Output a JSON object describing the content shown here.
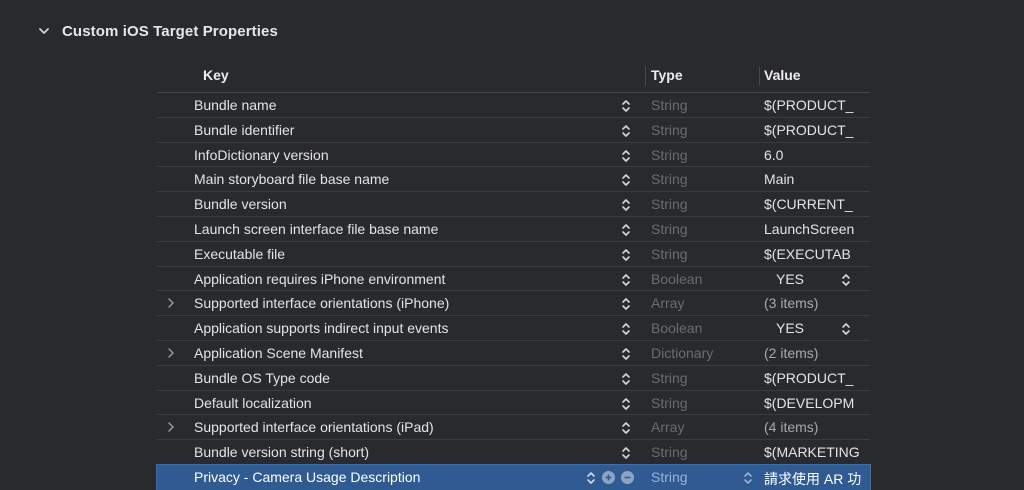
{
  "section": {
    "title": "Custom iOS Target Properties"
  },
  "columns": {
    "key": "Key",
    "type": "Type",
    "value": "Value"
  },
  "rows": [
    {
      "key": "Bundle name",
      "type": "String",
      "value": "$(PRODUCT_",
      "expandable": false
    },
    {
      "key": "Bundle identifier",
      "type": "String",
      "value": "$(PRODUCT_",
      "expandable": false
    },
    {
      "key": "InfoDictionary version",
      "type": "String",
      "value": "6.0",
      "expandable": false
    },
    {
      "key": "Main storyboard file base name",
      "type": "String",
      "value": "Main",
      "expandable": false
    },
    {
      "key": "Bundle version",
      "type": "String",
      "value": "$(CURRENT_",
      "expandable": false
    },
    {
      "key": "Launch screen interface file base name",
      "type": "String",
      "value": "LaunchScreen",
      "expandable": false
    },
    {
      "key": "Executable file",
      "type": "String",
      "value": "$(EXECUTAB",
      "expandable": false
    },
    {
      "key": "Application requires iPhone environment",
      "type": "Boolean",
      "value": "YES",
      "expandable": false
    },
    {
      "key": "Supported interface orientations (iPhone)",
      "type": "Array",
      "value": "(3 items)",
      "expandable": true
    },
    {
      "key": "Application supports indirect input events",
      "type": "Boolean",
      "value": "YES",
      "expandable": false
    },
    {
      "key": "Application Scene Manifest",
      "type": "Dictionary",
      "value": "(2 items)",
      "expandable": true
    },
    {
      "key": "Bundle OS Type code",
      "type": "String",
      "value": "$(PRODUCT_",
      "expandable": false
    },
    {
      "key": "Default localization",
      "type": "String",
      "value": "$(DEVELOPM",
      "expandable": false
    },
    {
      "key": "Supported interface orientations (iPad)",
      "type": "Array",
      "value": "(4 items)",
      "expandable": true
    },
    {
      "key": "Bundle version string (short)",
      "type": "String",
      "value": "$(MARKETING",
      "expandable": false
    },
    {
      "key": "Privacy - Camera Usage Description",
      "type": "String",
      "value": "請求使用 AR 功",
      "expandable": false,
      "selected": true
    }
  ],
  "colors": {
    "background": "#292a2e",
    "selection": "#2f5b92",
    "muted_text": "#6b6c70"
  }
}
